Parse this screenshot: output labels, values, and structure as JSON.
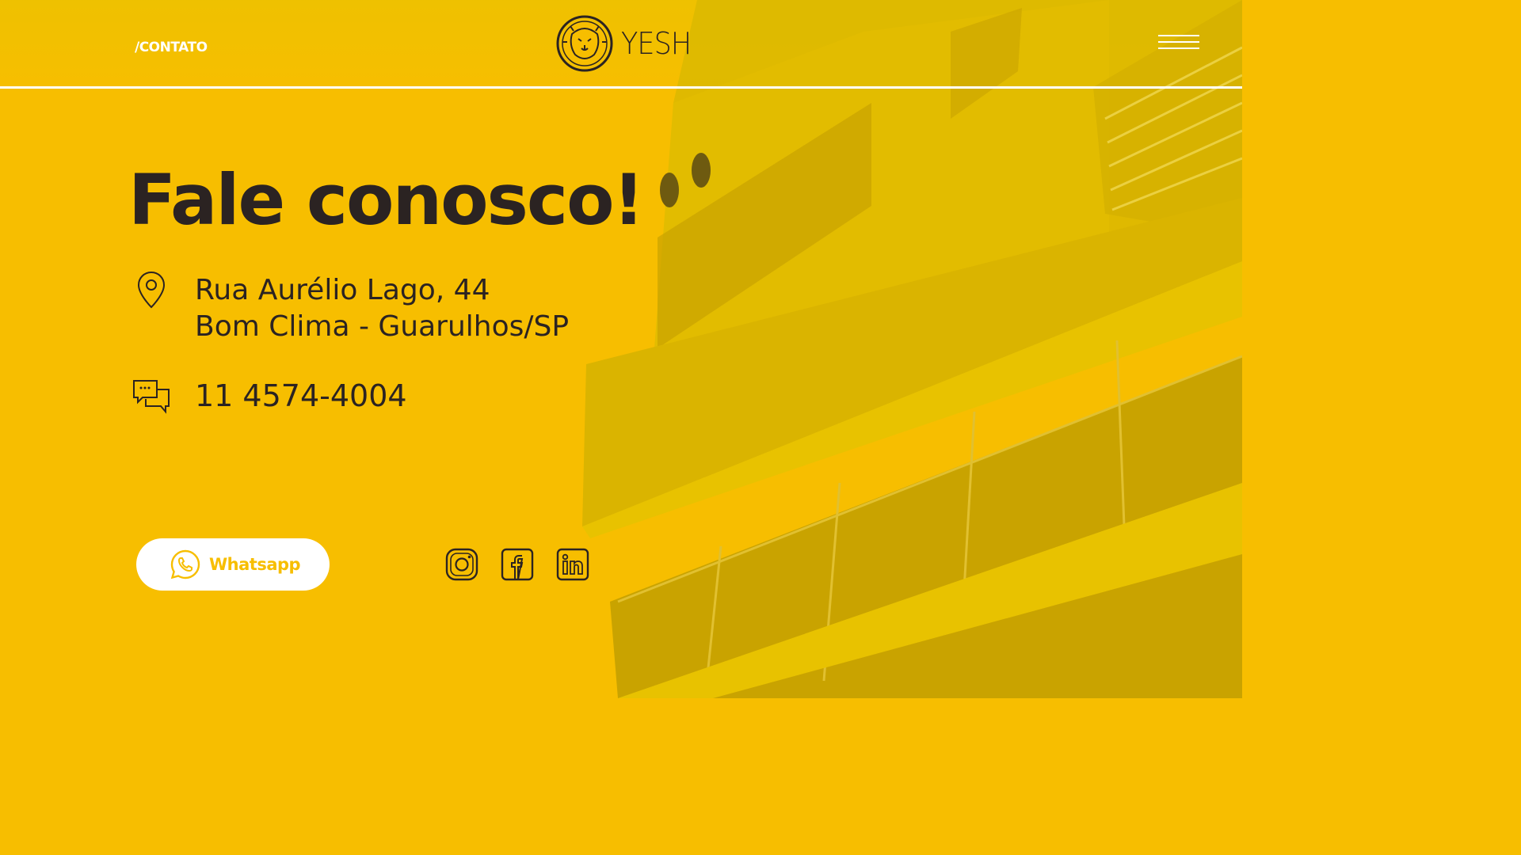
{
  "header": {
    "breadcrumb": "/CONTATO",
    "logo_text": "YESH"
  },
  "main": {
    "title": "Fale conosco!",
    "address_line1": "Rua Aurélio Lago, 44",
    "address_line2": "Bom Clima - Guarulhos/SP",
    "phone": "11 4574-4004",
    "whatsapp_label": "Whatsapp"
  },
  "social": {
    "icons": [
      "instagram-icon",
      "facebook-icon",
      "linkedin-icon"
    ]
  },
  "colors": {
    "background": "#F7BE00",
    "text": "#2b2322",
    "white": "#FFFFFF"
  }
}
